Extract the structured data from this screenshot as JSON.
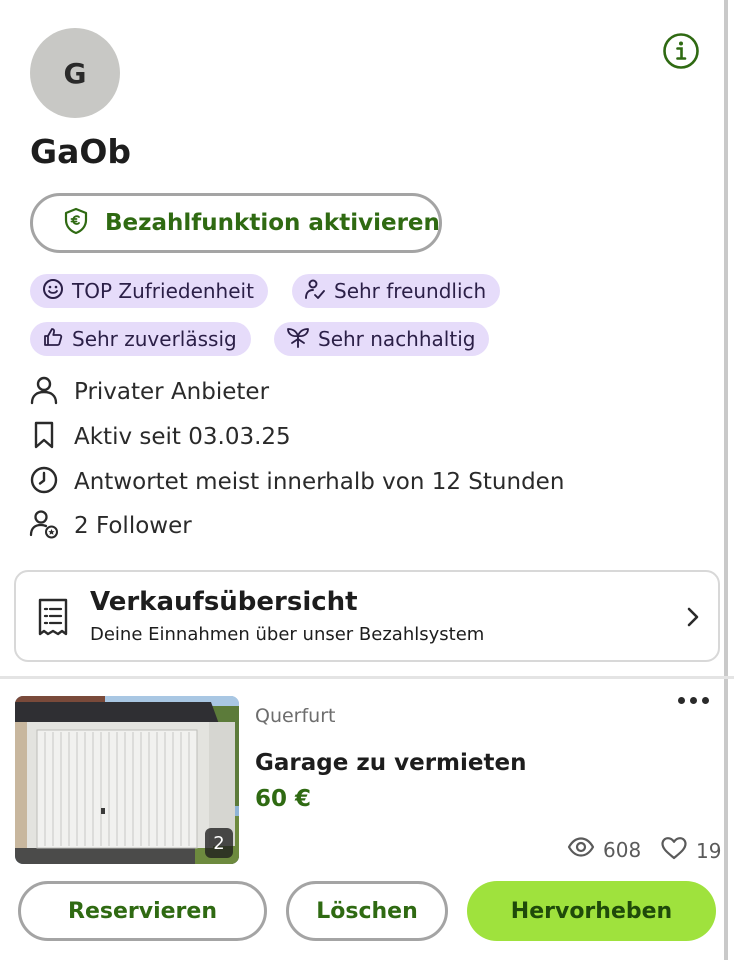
{
  "profile": {
    "avatar_initial": "G",
    "username": "GaOb",
    "pay_button_label": "Bezahlfunktion aktivieren"
  },
  "badges": [
    {
      "label": "TOP Zufriedenheit",
      "icon": "smiley-icon"
    },
    {
      "label": "Sehr freundlich",
      "icon": "friendly-person-icon"
    },
    {
      "label": "Sehr zuverlässig",
      "icon": "thumbs-up-icon"
    },
    {
      "label": "Sehr nachhaltig",
      "icon": "plant-icon"
    }
  ],
  "info": [
    {
      "text": "Privater Anbieter",
      "icon": "person-icon"
    },
    {
      "text": "Aktiv seit 03.03.25",
      "icon": "bookmark-icon"
    },
    {
      "text": "Antwortet meist innerhalb von 12 Stunden",
      "icon": "clock-icon"
    },
    {
      "text": "2 Follower",
      "icon": "follower-icon"
    }
  ],
  "sales_overview": {
    "title": "Verkaufsübersicht",
    "subtitle": "Deine Einnahmen über unser Bezahlsystem"
  },
  "listing": {
    "image_count": "2",
    "location": "Querfurt",
    "title": "Garage zu vermieten",
    "price": "60 €",
    "views": "608",
    "likes": "19"
  },
  "actions": {
    "reserve": "Reservieren",
    "delete": "Löschen",
    "highlight": "Hervorheben"
  },
  "colors": {
    "accent_green": "#2f6a12",
    "primary_button": "#9fe23d",
    "badge_bg": "#e6dcfa"
  }
}
